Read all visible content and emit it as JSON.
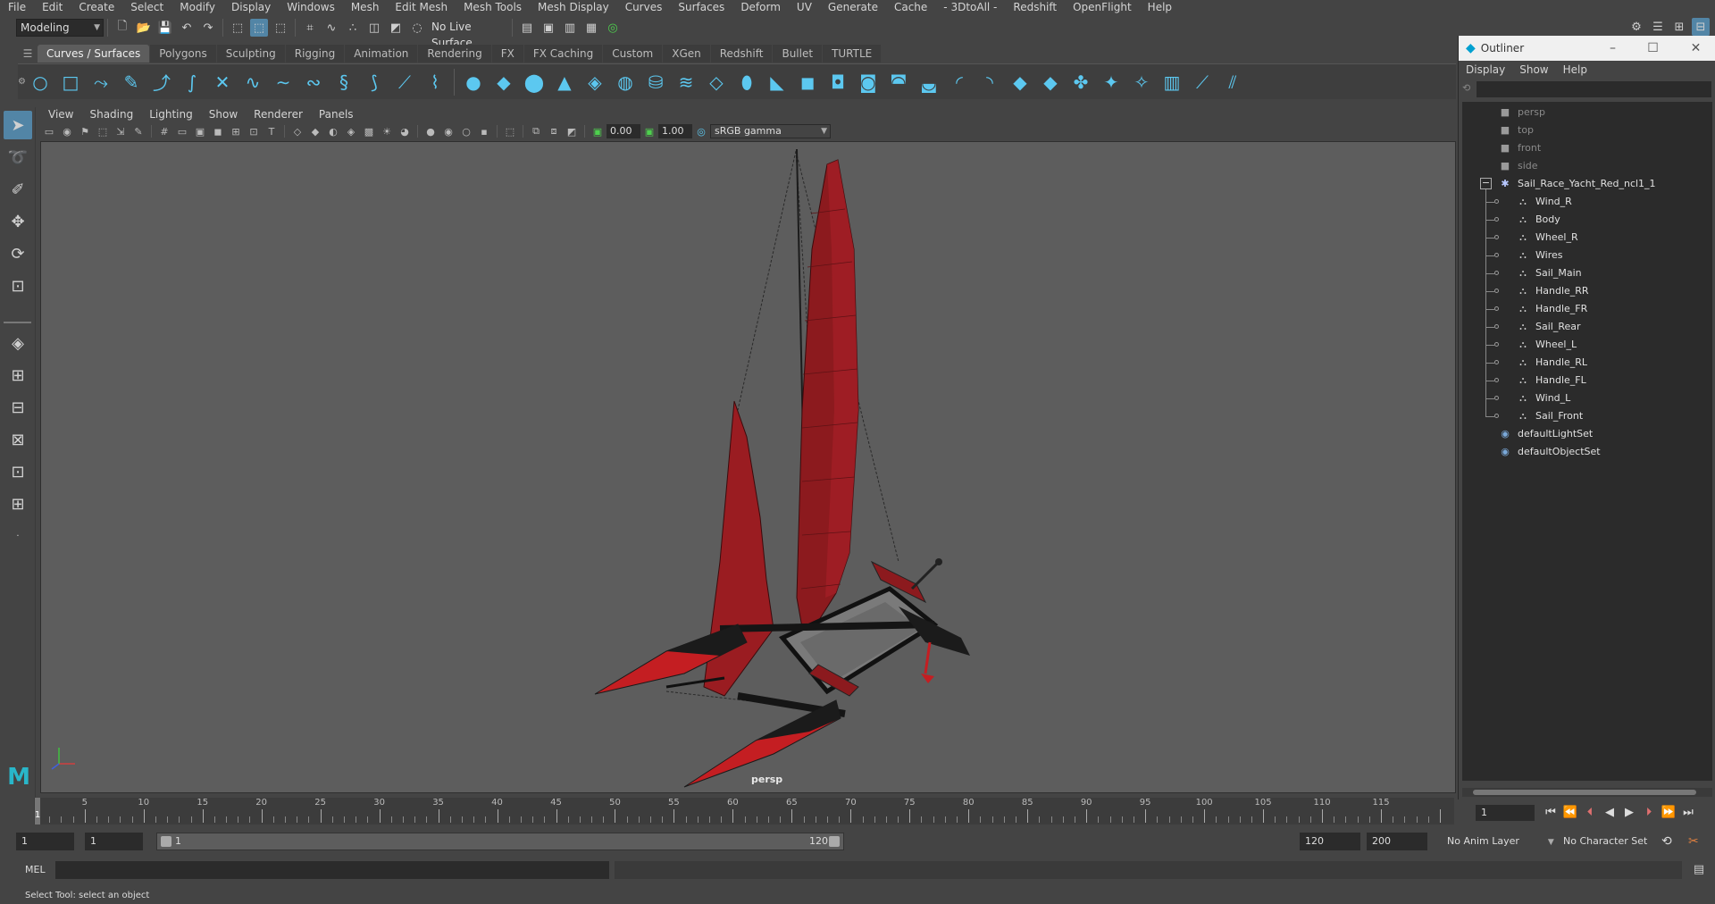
{
  "menu": [
    "File",
    "Edit",
    "Create",
    "Select",
    "Modify",
    "Display",
    "Windows",
    "Mesh",
    "Edit Mesh",
    "Mesh Tools",
    "Mesh Display",
    "Curves",
    "Surfaces",
    "Deform",
    "UV",
    "Generate",
    "Cache",
    "- 3DtoAll -",
    "Redshift",
    "OpenFlight",
    "Help"
  ],
  "status": {
    "workspace": "Modeling",
    "live_surface": "No Live Surface"
  },
  "shelf_tabs": [
    "Curves / Surfaces",
    "Polygons",
    "Sculpting",
    "Rigging",
    "Animation",
    "Rendering",
    "FX",
    "FX Caching",
    "Custom",
    "XGen",
    "Redshift",
    "Bullet",
    "TURTLE"
  ],
  "shelf_active": "Curves / Surfaces",
  "panel_menu": [
    "View",
    "Shading",
    "Lighting",
    "Show",
    "Renderer",
    "Panels"
  ],
  "panel_toolbar": {
    "exposure": "0.00",
    "gamma": "1.00",
    "color_space": "sRGB gamma"
  },
  "viewport": {
    "camera": "persp"
  },
  "outliner": {
    "title": "Outliner",
    "menu": [
      "Display",
      "Show",
      "Help"
    ],
    "cameras": [
      "persp",
      "top",
      "front",
      "side"
    ],
    "group": "Sail_Race_Yacht_Red_ncl1_1",
    "children": [
      "Wind_R",
      "Body",
      "Wheel_R",
      "Wires",
      "Sail_Main",
      "Handle_RR",
      "Handle_FR",
      "Sail_Rear",
      "Wheel_L",
      "Handle_RL",
      "Handle_FL",
      "Wind_L",
      "Sail_Front"
    ],
    "sets": [
      "defaultLightSet",
      "defaultObjectSet"
    ]
  },
  "timeline": {
    "labels": [
      "5",
      "10",
      "15",
      "20",
      "25",
      "30",
      "35",
      "40",
      "45",
      "50",
      "55",
      "60",
      "65",
      "70",
      "75",
      "80",
      "85",
      "90",
      "95",
      "100",
      "105",
      "110",
      "115"
    ],
    "playhead_label": "1",
    "current_frame": "1"
  },
  "range": {
    "start": "1",
    "playback_start": "1",
    "slider_start": "1",
    "slider_end": "120",
    "playback_end": "120",
    "end": "200",
    "anim_layer": "No Anim Layer",
    "char_set": "No Character Set"
  },
  "command": {
    "label": "MEL"
  },
  "help_line": "Select Tool: select an object"
}
